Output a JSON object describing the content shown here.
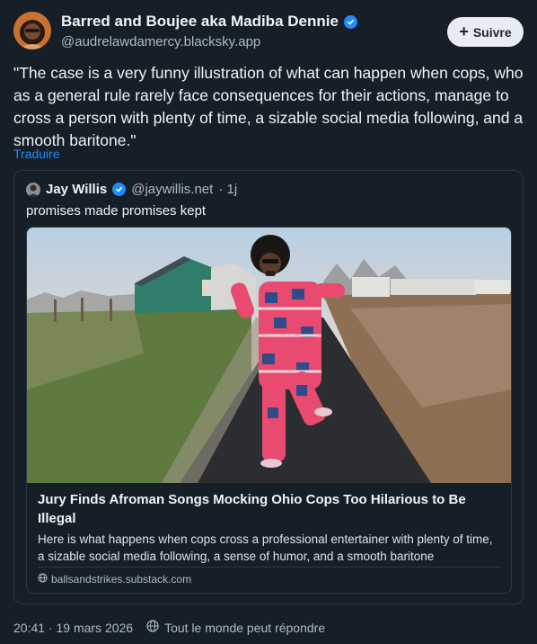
{
  "author": {
    "name": "Barred and Boujee aka Madiba Dennie",
    "handle": "@audrelawdamercy.blacksky.app",
    "avatar_icon": "profile-photo"
  },
  "follow_button": {
    "label": "Suivre"
  },
  "post": {
    "text": "\"The case is a very funny illustration of what can happen when cops, who as a general rule rarely face consequences for their actions, manage to cross a person with plenty of time, a sizable social media following, and a smooth baritone.\"",
    "translate_label": "Traduire"
  },
  "quote": {
    "name": "Jay Willis",
    "handle": "@jaywillis.net",
    "time": "· 1j",
    "text": "promises made promises kept",
    "link": {
      "title": "Jury Finds Afroman Songs Mocking Ohio Cops Too Hilarious to Be Illegal",
      "description": "Here is what happens when cops cross a professional entertainer with plenty of time, a sizable social media following, a sense of humor, and a smooth baritone",
      "domain": "ballsandstrikes.substack.com"
    }
  },
  "footer": {
    "timestamp": "20:41 · 19 mars 2026",
    "reply_setting": "Tout le monde peut répondre"
  },
  "colors": {
    "background": "#161e27",
    "accent": "#208bfe",
    "muted_text": "#aebbc9"
  }
}
